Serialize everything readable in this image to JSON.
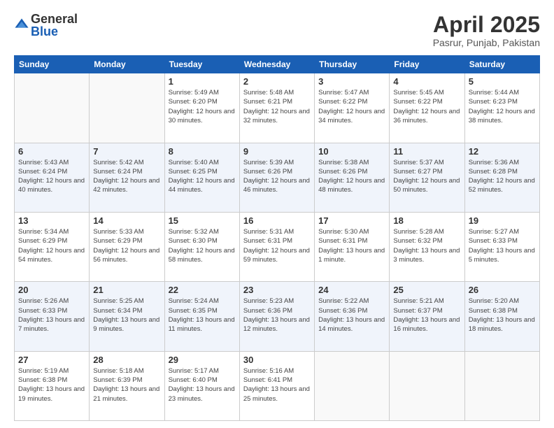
{
  "header": {
    "logo_general": "General",
    "logo_blue": "Blue",
    "month_year": "April 2025",
    "location": "Pasrur, Punjab, Pakistan"
  },
  "days_of_week": [
    "Sunday",
    "Monday",
    "Tuesday",
    "Wednesday",
    "Thursday",
    "Friday",
    "Saturday"
  ],
  "weeks": [
    [
      {
        "day": "",
        "info": ""
      },
      {
        "day": "",
        "info": ""
      },
      {
        "day": "1",
        "info": "Sunrise: 5:49 AM\nSunset: 6:20 PM\nDaylight: 12 hours and 30 minutes."
      },
      {
        "day": "2",
        "info": "Sunrise: 5:48 AM\nSunset: 6:21 PM\nDaylight: 12 hours and 32 minutes."
      },
      {
        "day": "3",
        "info": "Sunrise: 5:47 AM\nSunset: 6:22 PM\nDaylight: 12 hours and 34 minutes."
      },
      {
        "day": "4",
        "info": "Sunrise: 5:45 AM\nSunset: 6:22 PM\nDaylight: 12 hours and 36 minutes."
      },
      {
        "day": "5",
        "info": "Sunrise: 5:44 AM\nSunset: 6:23 PM\nDaylight: 12 hours and 38 minutes."
      }
    ],
    [
      {
        "day": "6",
        "info": "Sunrise: 5:43 AM\nSunset: 6:24 PM\nDaylight: 12 hours and 40 minutes."
      },
      {
        "day": "7",
        "info": "Sunrise: 5:42 AM\nSunset: 6:24 PM\nDaylight: 12 hours and 42 minutes."
      },
      {
        "day": "8",
        "info": "Sunrise: 5:40 AM\nSunset: 6:25 PM\nDaylight: 12 hours and 44 minutes."
      },
      {
        "day": "9",
        "info": "Sunrise: 5:39 AM\nSunset: 6:26 PM\nDaylight: 12 hours and 46 minutes."
      },
      {
        "day": "10",
        "info": "Sunrise: 5:38 AM\nSunset: 6:26 PM\nDaylight: 12 hours and 48 minutes."
      },
      {
        "day": "11",
        "info": "Sunrise: 5:37 AM\nSunset: 6:27 PM\nDaylight: 12 hours and 50 minutes."
      },
      {
        "day": "12",
        "info": "Sunrise: 5:36 AM\nSunset: 6:28 PM\nDaylight: 12 hours and 52 minutes."
      }
    ],
    [
      {
        "day": "13",
        "info": "Sunrise: 5:34 AM\nSunset: 6:29 PM\nDaylight: 12 hours and 54 minutes."
      },
      {
        "day": "14",
        "info": "Sunrise: 5:33 AM\nSunset: 6:29 PM\nDaylight: 12 hours and 56 minutes."
      },
      {
        "day": "15",
        "info": "Sunrise: 5:32 AM\nSunset: 6:30 PM\nDaylight: 12 hours and 58 minutes."
      },
      {
        "day": "16",
        "info": "Sunrise: 5:31 AM\nSunset: 6:31 PM\nDaylight: 12 hours and 59 minutes."
      },
      {
        "day": "17",
        "info": "Sunrise: 5:30 AM\nSunset: 6:31 PM\nDaylight: 13 hours and 1 minute."
      },
      {
        "day": "18",
        "info": "Sunrise: 5:28 AM\nSunset: 6:32 PM\nDaylight: 13 hours and 3 minutes."
      },
      {
        "day": "19",
        "info": "Sunrise: 5:27 AM\nSunset: 6:33 PM\nDaylight: 13 hours and 5 minutes."
      }
    ],
    [
      {
        "day": "20",
        "info": "Sunrise: 5:26 AM\nSunset: 6:33 PM\nDaylight: 13 hours and 7 minutes."
      },
      {
        "day": "21",
        "info": "Sunrise: 5:25 AM\nSunset: 6:34 PM\nDaylight: 13 hours and 9 minutes."
      },
      {
        "day": "22",
        "info": "Sunrise: 5:24 AM\nSunset: 6:35 PM\nDaylight: 13 hours and 11 minutes."
      },
      {
        "day": "23",
        "info": "Sunrise: 5:23 AM\nSunset: 6:36 PM\nDaylight: 13 hours and 12 minutes."
      },
      {
        "day": "24",
        "info": "Sunrise: 5:22 AM\nSunset: 6:36 PM\nDaylight: 13 hours and 14 minutes."
      },
      {
        "day": "25",
        "info": "Sunrise: 5:21 AM\nSunset: 6:37 PM\nDaylight: 13 hours and 16 minutes."
      },
      {
        "day": "26",
        "info": "Sunrise: 5:20 AM\nSunset: 6:38 PM\nDaylight: 13 hours and 18 minutes."
      }
    ],
    [
      {
        "day": "27",
        "info": "Sunrise: 5:19 AM\nSunset: 6:38 PM\nDaylight: 13 hours and 19 minutes."
      },
      {
        "day": "28",
        "info": "Sunrise: 5:18 AM\nSunset: 6:39 PM\nDaylight: 13 hours and 21 minutes."
      },
      {
        "day": "29",
        "info": "Sunrise: 5:17 AM\nSunset: 6:40 PM\nDaylight: 13 hours and 23 minutes."
      },
      {
        "day": "30",
        "info": "Sunrise: 5:16 AM\nSunset: 6:41 PM\nDaylight: 13 hours and 25 minutes."
      },
      {
        "day": "",
        "info": ""
      },
      {
        "day": "",
        "info": ""
      },
      {
        "day": "",
        "info": ""
      }
    ]
  ]
}
